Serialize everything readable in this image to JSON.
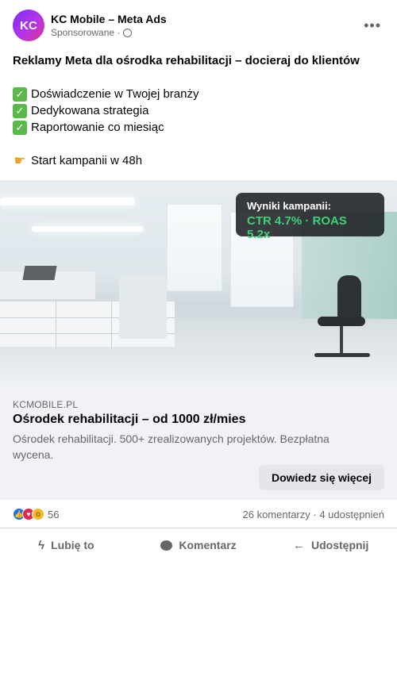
{
  "post": {
    "page_name": "KC Mobile – Meta Ads",
    "avatar_initials": "KC",
    "sponsored_label": "Sponsorowane ·",
    "headline": "Reklamy Meta dla ośrodka rehabilitacji – docieraj do klientów",
    "benefits": [
      "Doświadczenie w Twojej branży",
      "Dedykowana strategia",
      "Raportowanie co miesiąc"
    ],
    "cta_line": "Start kampanii w 48h",
    "more_icon": "•••"
  },
  "media": {
    "overlay_label": "Wyniki kampanii:",
    "overlay_value": "CTR 4.7% · ROAS 5.2x",
    "overlay_value_color": "#3fd17a"
  },
  "link": {
    "domain": "KCMOBILE.PL",
    "title": "Ośrodek rehabilitacji – od 1000 zł/mies",
    "description": "Ośrodek rehabilitacji. 500+ zrealizowanych projektów. Bezpłatna wycena.",
    "button_label": "Dowiedz się więcej"
  },
  "stats": {
    "reaction_count": "56",
    "comments_shares": "26 komentarzy · 4 udostępnień"
  },
  "actions": {
    "like": "Lubię to",
    "comment": "Komentarz",
    "share": "Udostępnij"
  },
  "colors": {
    "accent": "#1b74e4",
    "text_secondary": "#65676b",
    "card_bg": "#f0f2f5"
  }
}
